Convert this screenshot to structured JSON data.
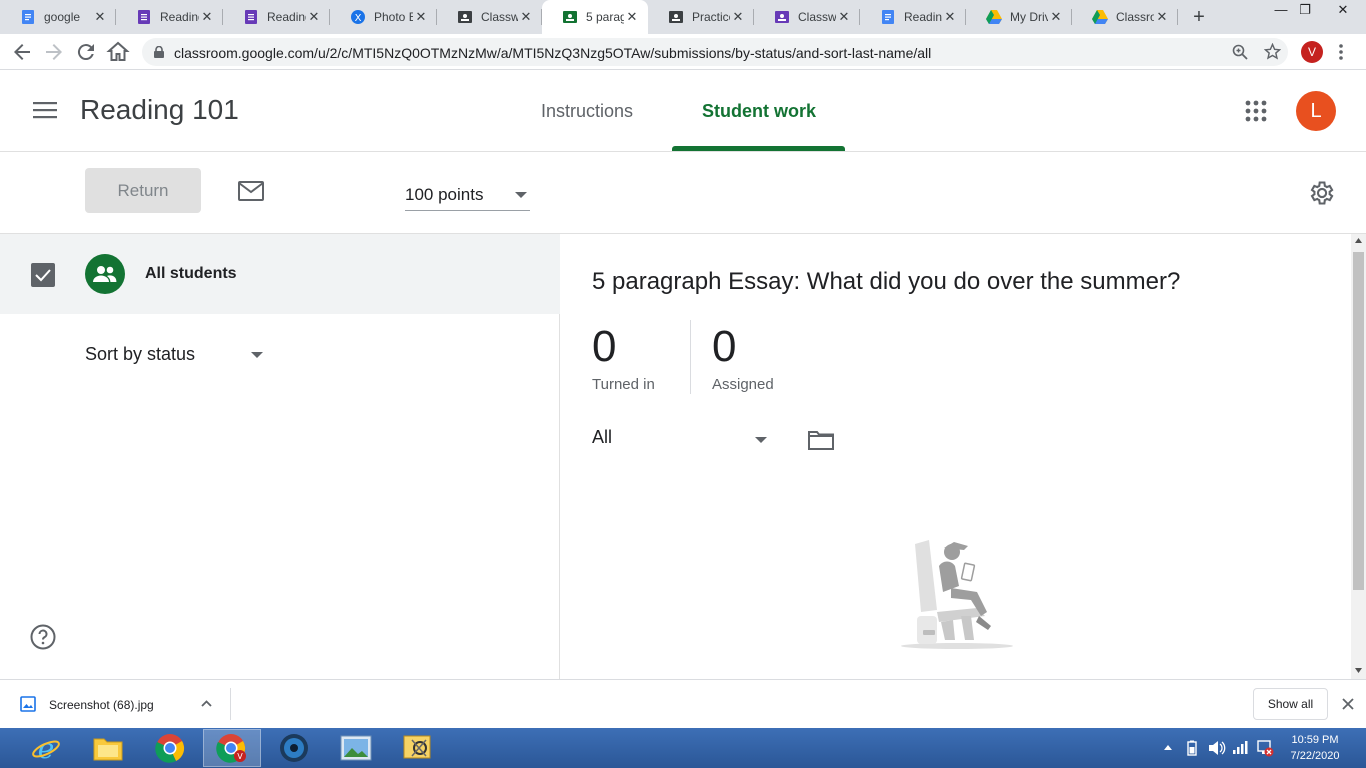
{
  "browser": {
    "tabs": [
      {
        "label": "google",
        "favicon": "docs-icon",
        "color": "#4285f4"
      },
      {
        "label": "Reading",
        "favicon": "forms-icon",
        "color": "#673ab7"
      },
      {
        "label": "Reading",
        "favicon": "forms-icon",
        "color": "#673ab7"
      },
      {
        "label": "Photo E",
        "favicon": "photo-editor-icon",
        "color": "#1a73e8"
      },
      {
        "label": "Classwo",
        "favicon": "classroom-icon",
        "color": "#3c4043"
      },
      {
        "label": "5 parag",
        "favicon": "classroom-icon",
        "color": "#137333"
      },
      {
        "label": "Practice",
        "favicon": "classroom-icon",
        "color": "#3c4043"
      },
      {
        "label": "Classwo",
        "favicon": "classroom-icon",
        "color": "#673ab7"
      },
      {
        "label": "Reading",
        "favicon": "docs-icon",
        "color": "#4285f4"
      },
      {
        "label": "My Driv",
        "favicon": "drive-icon",
        "color": "#fbbc04"
      },
      {
        "label": "Classroo",
        "favicon": "drive-icon",
        "color": "#fbbc04"
      }
    ],
    "active_tab": 5,
    "url": "classroom.google.com/u/2/c/MTI5NzQ0OTMzNzMw/a/MTI5NzQ3Nzg5OTAw/submissions/by-status/and-sort-last-name/all",
    "profile_initial": "V"
  },
  "classroom": {
    "class_title": "Reading 101",
    "tabs": [
      "Instructions",
      "Student work"
    ],
    "active_tab": "Student work",
    "avatar_initial": "L",
    "accent_color": "#137333",
    "avatar_color": "#e8501f"
  },
  "actionbar": {
    "return_label": "Return",
    "points_value": "100 points"
  },
  "left_panel": {
    "all_students_label": "All students",
    "sort_value": "Sort by status"
  },
  "right_panel": {
    "assignment_title": "5 paragraph Essay: What did you do over the summer?",
    "stats": [
      {
        "value": "0",
        "label": "Turned in"
      },
      {
        "value": "0",
        "label": "Assigned"
      }
    ],
    "filter_value": "All"
  },
  "download_bar": {
    "file_name": "Screenshot (68).jpg",
    "show_all_label": "Show all"
  },
  "taskbar": {
    "time": "10:59 PM",
    "date": "7/22/2020"
  }
}
